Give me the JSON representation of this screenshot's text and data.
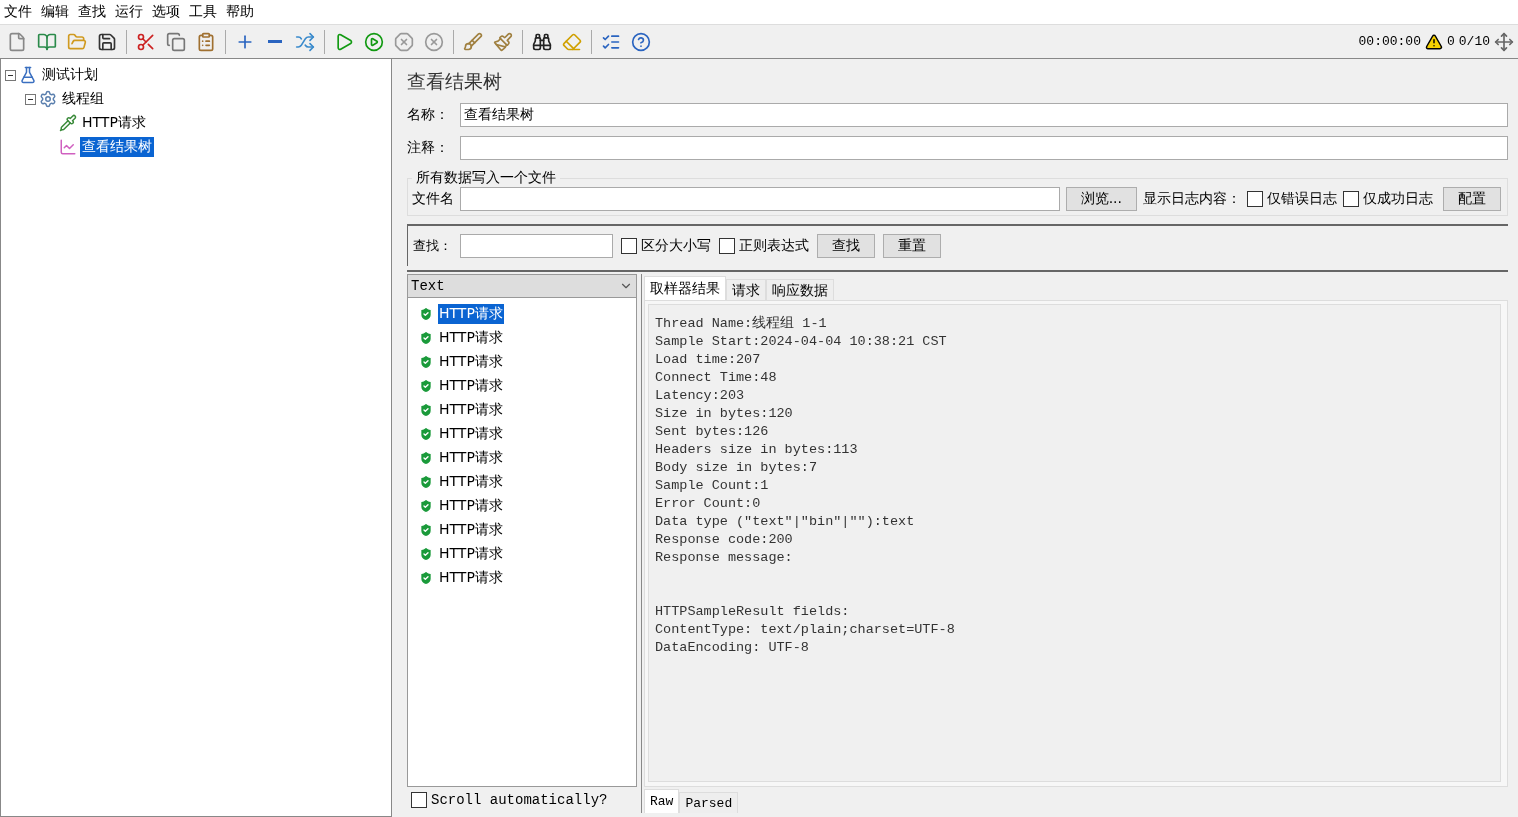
{
  "menu": [
    "文件",
    "编辑",
    "查找",
    "运行",
    "选项",
    "工具",
    "帮助"
  ],
  "status": {
    "timer": "00:00:00",
    "warnings": "0",
    "threads": "0/10"
  },
  "tree": [
    {
      "label": "测试计划",
      "kind": "plan",
      "selected": false,
      "expanded": true,
      "children": [
        {
          "label": "线程组",
          "kind": "threads",
          "selected": false,
          "expanded": true,
          "children": [
            {
              "label": "HTTP请求",
              "kind": "sampler",
              "selected": false
            },
            {
              "label": "查看结果树",
              "kind": "listener",
              "selected": true
            }
          ]
        }
      ]
    }
  ],
  "panel": {
    "title": "查看结果树",
    "name_label": "名称：",
    "name_value": "查看结果树",
    "comment_label": "注释：",
    "file_group": {
      "title": "所有数据写入一个文件",
      "file_label": "文件名",
      "browse": "浏览...",
      "log_label": "显示日志内容：",
      "options": [
        {
          "label": "仅错误日志",
          "checked": false
        },
        {
          "label": "仅成功日志",
          "checked": false
        }
      ],
      "configure": "配置"
    }
  },
  "search": {
    "label": "查找：",
    "options": [
      {
        "label": "区分大小写",
        "checked": false
      },
      {
        "label": "正则表达式",
        "checked": false
      }
    ],
    "find": "查找",
    "reset": "重置"
  },
  "results": {
    "renderer": "Text",
    "items": [
      {
        "label": "HTTP请求",
        "selected": true
      },
      {
        "label": "HTTP请求",
        "selected": false
      },
      {
        "label": "HTTP请求",
        "selected": false
      },
      {
        "label": "HTTP请求",
        "selected": false
      },
      {
        "label": "HTTP请求",
        "selected": false
      },
      {
        "label": "HTTP请求",
        "selected": false
      },
      {
        "label": "HTTP请求",
        "selected": false
      },
      {
        "label": "HTTP请求",
        "selected": false
      },
      {
        "label": "HTTP请求",
        "selected": false
      },
      {
        "label": "HTTP请求",
        "selected": false
      },
      {
        "label": "HTTP请求",
        "selected": false
      },
      {
        "label": "HTTP请求",
        "selected": false
      }
    ],
    "scroll": {
      "label": "Scroll automatically?",
      "checked": false
    }
  },
  "detail": {
    "tabs": [
      {
        "label": "取样器结果",
        "selected": true
      },
      {
        "label": "请求",
        "selected": false
      },
      {
        "label": "响应数据",
        "selected": false
      }
    ],
    "text": "Thread Name:线程组 1-1\nSample Start:2024-04-04 10:38:21 CST\nLoad time:207\nConnect Time:48\nLatency:203\nSize in bytes:120\nSent bytes:126\nHeaders size in bytes:113\nBody size in bytes:7\nSample Count:1\nError Count:0\nData type (\"text\"|\"bin\"|\"\"):text\nResponse code:200\nResponse message:\n\n\nHTTPSampleResult fields:\nContentType: text/plain;charset=UTF-8\nDataEncoding: UTF-8",
    "bottom_tabs": [
      {
        "label": "Raw",
        "selected": true
      },
      {
        "label": "Parsed",
        "selected": false
      }
    ]
  }
}
